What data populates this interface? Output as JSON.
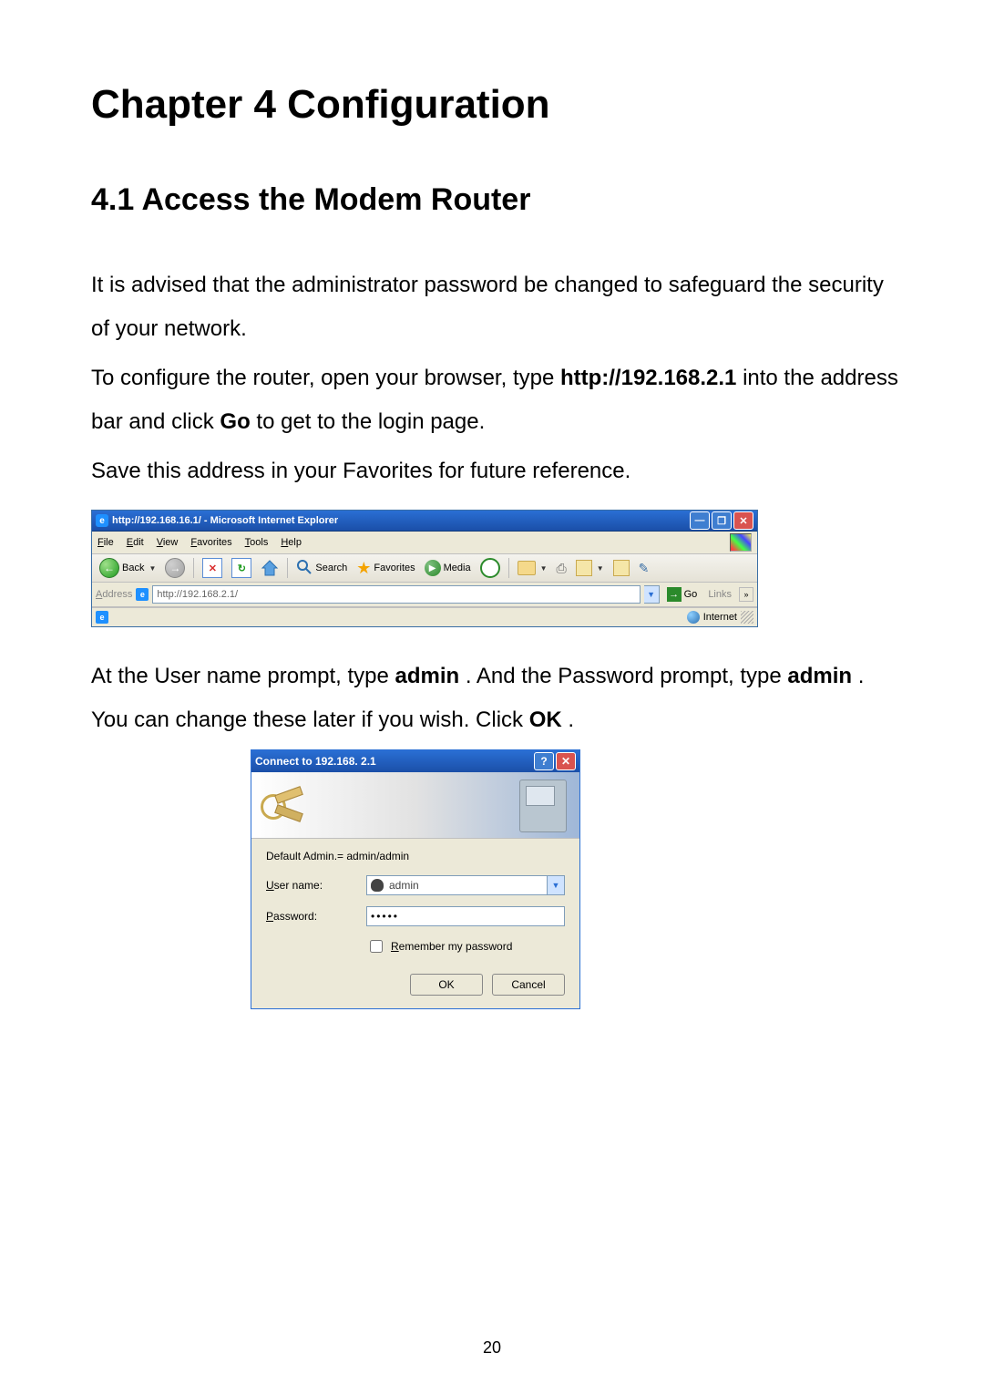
{
  "chapter_title": "Chapter 4    Configuration",
  "section_title": "4.1 Access the Modem Router",
  "para1": "It is advised that the administrator password be changed to safeguard the security of your network.",
  "para2_a": "To configure the router, open your browser, type ",
  "para2_bold1": "http://192.168.2.1",
  "para2_b": " into the address bar and click ",
  "para2_bold2": "Go",
  "para2_c": " to get to the login page.",
  "para3": "Save this address in your Favorites for future reference.",
  "para4_a": "At the User name prompt, type ",
  "para4_bold1": "admin",
  "para4_b": ". And the Password prompt, type ",
  "para4_bold2": "admin",
  "para4_c": ". You can change these later if you wish. Click ",
  "para4_bold3": "OK",
  "para4_d": ".",
  "page_number": "20",
  "ie": {
    "title": "http://192.168.16.1/ - Microsoft Internet Explorer",
    "menu": {
      "file": "File",
      "edit": "Edit",
      "view": "View",
      "favorites": "Favorites",
      "tools": "Tools",
      "help": "Help"
    },
    "toolbar": {
      "back": "Back",
      "search": "Search",
      "favorites": "Favorites",
      "media": "Media"
    },
    "address_label": "Address",
    "address_value": "http://192.168.2.1/",
    "go_label": "Go",
    "links_label": "Links",
    "status_zone": "Internet"
  },
  "dialog": {
    "title": "Connect to 192.168. 2.1",
    "hint": "Default Admin.= admin/admin",
    "username_label": "User name:",
    "username_value": "admin",
    "password_label": "Password:",
    "password_value": "•••••",
    "remember_label": "Remember my password",
    "ok_label": "OK",
    "cancel_label": "Cancel"
  }
}
